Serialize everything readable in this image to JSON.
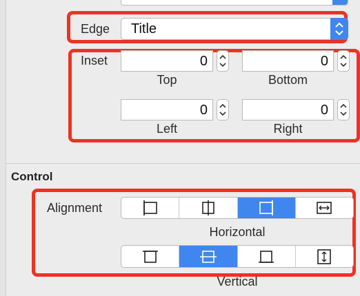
{
  "edge": {
    "label": "Edge",
    "value": "Title"
  },
  "inset": {
    "label": "Inset",
    "fields": [
      {
        "id": "top",
        "value": "0",
        "caption": "Top"
      },
      {
        "id": "bottom",
        "value": "0",
        "caption": "Bottom"
      },
      {
        "id": "left",
        "value": "0",
        "caption": "Left"
      },
      {
        "id": "right",
        "value": "0",
        "caption": "Right"
      }
    ]
  },
  "control": {
    "heading": "Control",
    "alignment_label": "Alignment",
    "horizontal_caption": "Horizontal",
    "vertical_caption": "Vertical",
    "horizontal_options": [
      {
        "icon": "align-left-icon",
        "selected": false
      },
      {
        "icon": "align-center-horizontal-icon",
        "selected": false
      },
      {
        "icon": "align-right-icon",
        "selected": true
      },
      {
        "icon": "fill-horizontal-icon",
        "selected": false
      }
    ],
    "vertical_options": [
      {
        "icon": "align-top-icon",
        "selected": false
      },
      {
        "icon": "align-center-vertical-icon",
        "selected": true
      },
      {
        "icon": "align-bottom-icon",
        "selected": false
      },
      {
        "icon": "fill-vertical-icon",
        "selected": false
      }
    ]
  },
  "colors": {
    "accent": "#3f87ef",
    "highlight": "#ee3224"
  }
}
